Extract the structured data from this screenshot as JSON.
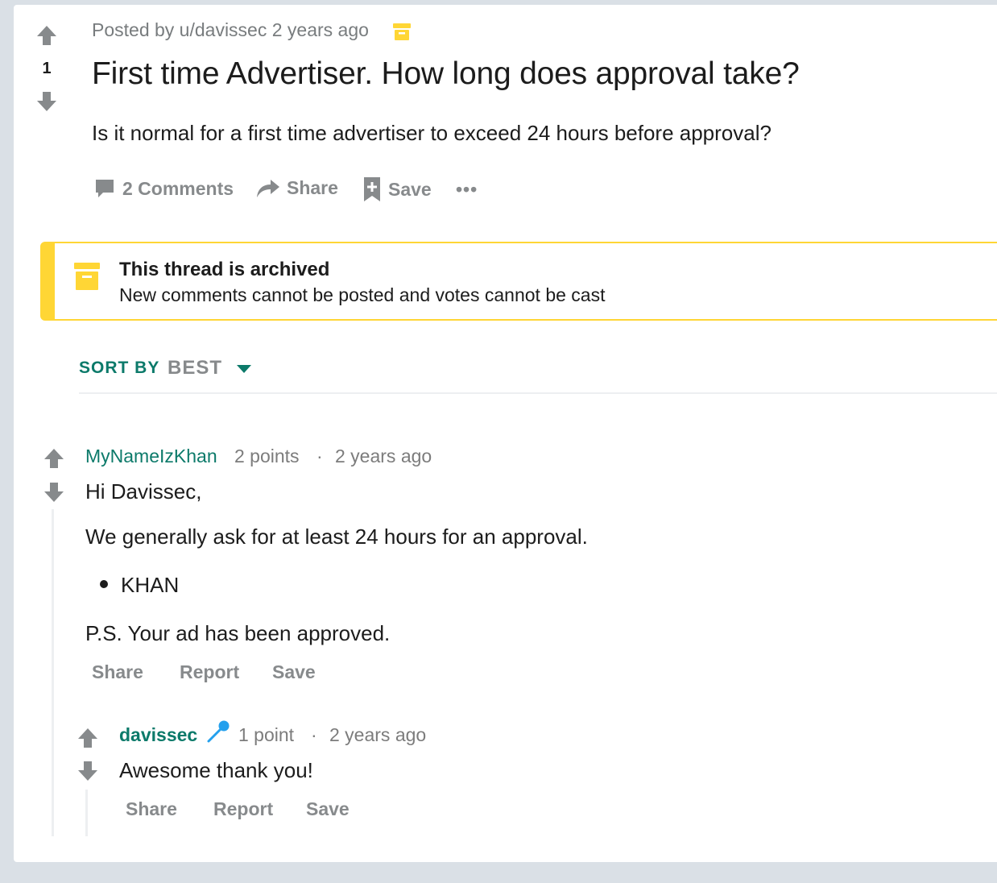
{
  "post": {
    "score": "1",
    "meta": "Posted by u/davissec 2 years ago",
    "title": "First time Advertiser. How long does approval take?",
    "body": "Is it normal for a first time advertiser to exceed 24 hours before approval?",
    "actions": {
      "comments": "2 Comments",
      "share": "Share",
      "save": "Save",
      "more": "•••"
    }
  },
  "archived": {
    "title": "This thread is archived",
    "subtitle": "New comments cannot be posted and votes cannot be cast"
  },
  "sort": {
    "label": "SORT BY",
    "value": "BEST"
  },
  "comments": [
    {
      "author": "MyNameIzKhan",
      "points": "2 points",
      "separator": "·",
      "time": "2 years ago",
      "paragraph1": "Hi Davissec,",
      "paragraph2": "We generally ask for at least 24 hours for an approval.",
      "list_item": "KHAN",
      "paragraph3": "P.S. Your ad has been approved.",
      "actions": {
        "share": "Share",
        "report": "Report",
        "save": "Save"
      }
    },
    {
      "author": "davissec",
      "points": "1 point",
      "separator": "·",
      "time": "2 years ago",
      "body": "Awesome thank you!",
      "actions": {
        "share": "Share",
        "report": "Report",
        "save": "Save"
      }
    }
  ],
  "colors": {
    "accent_green": "#0c7a6a",
    "archive_yellow": "#ffd635",
    "muted_gray": "#878a8c",
    "mic_blue": "#24a0ed"
  },
  "icons": {
    "upvote": "arrow-up-icon",
    "downvote": "arrow-down-icon",
    "archive": "archive-box-icon",
    "comment": "comment-bubble-icon",
    "share": "share-arrow-icon",
    "save": "bookmark-plus-icon",
    "caret": "caret-down-icon",
    "mic": "microphone-icon"
  }
}
